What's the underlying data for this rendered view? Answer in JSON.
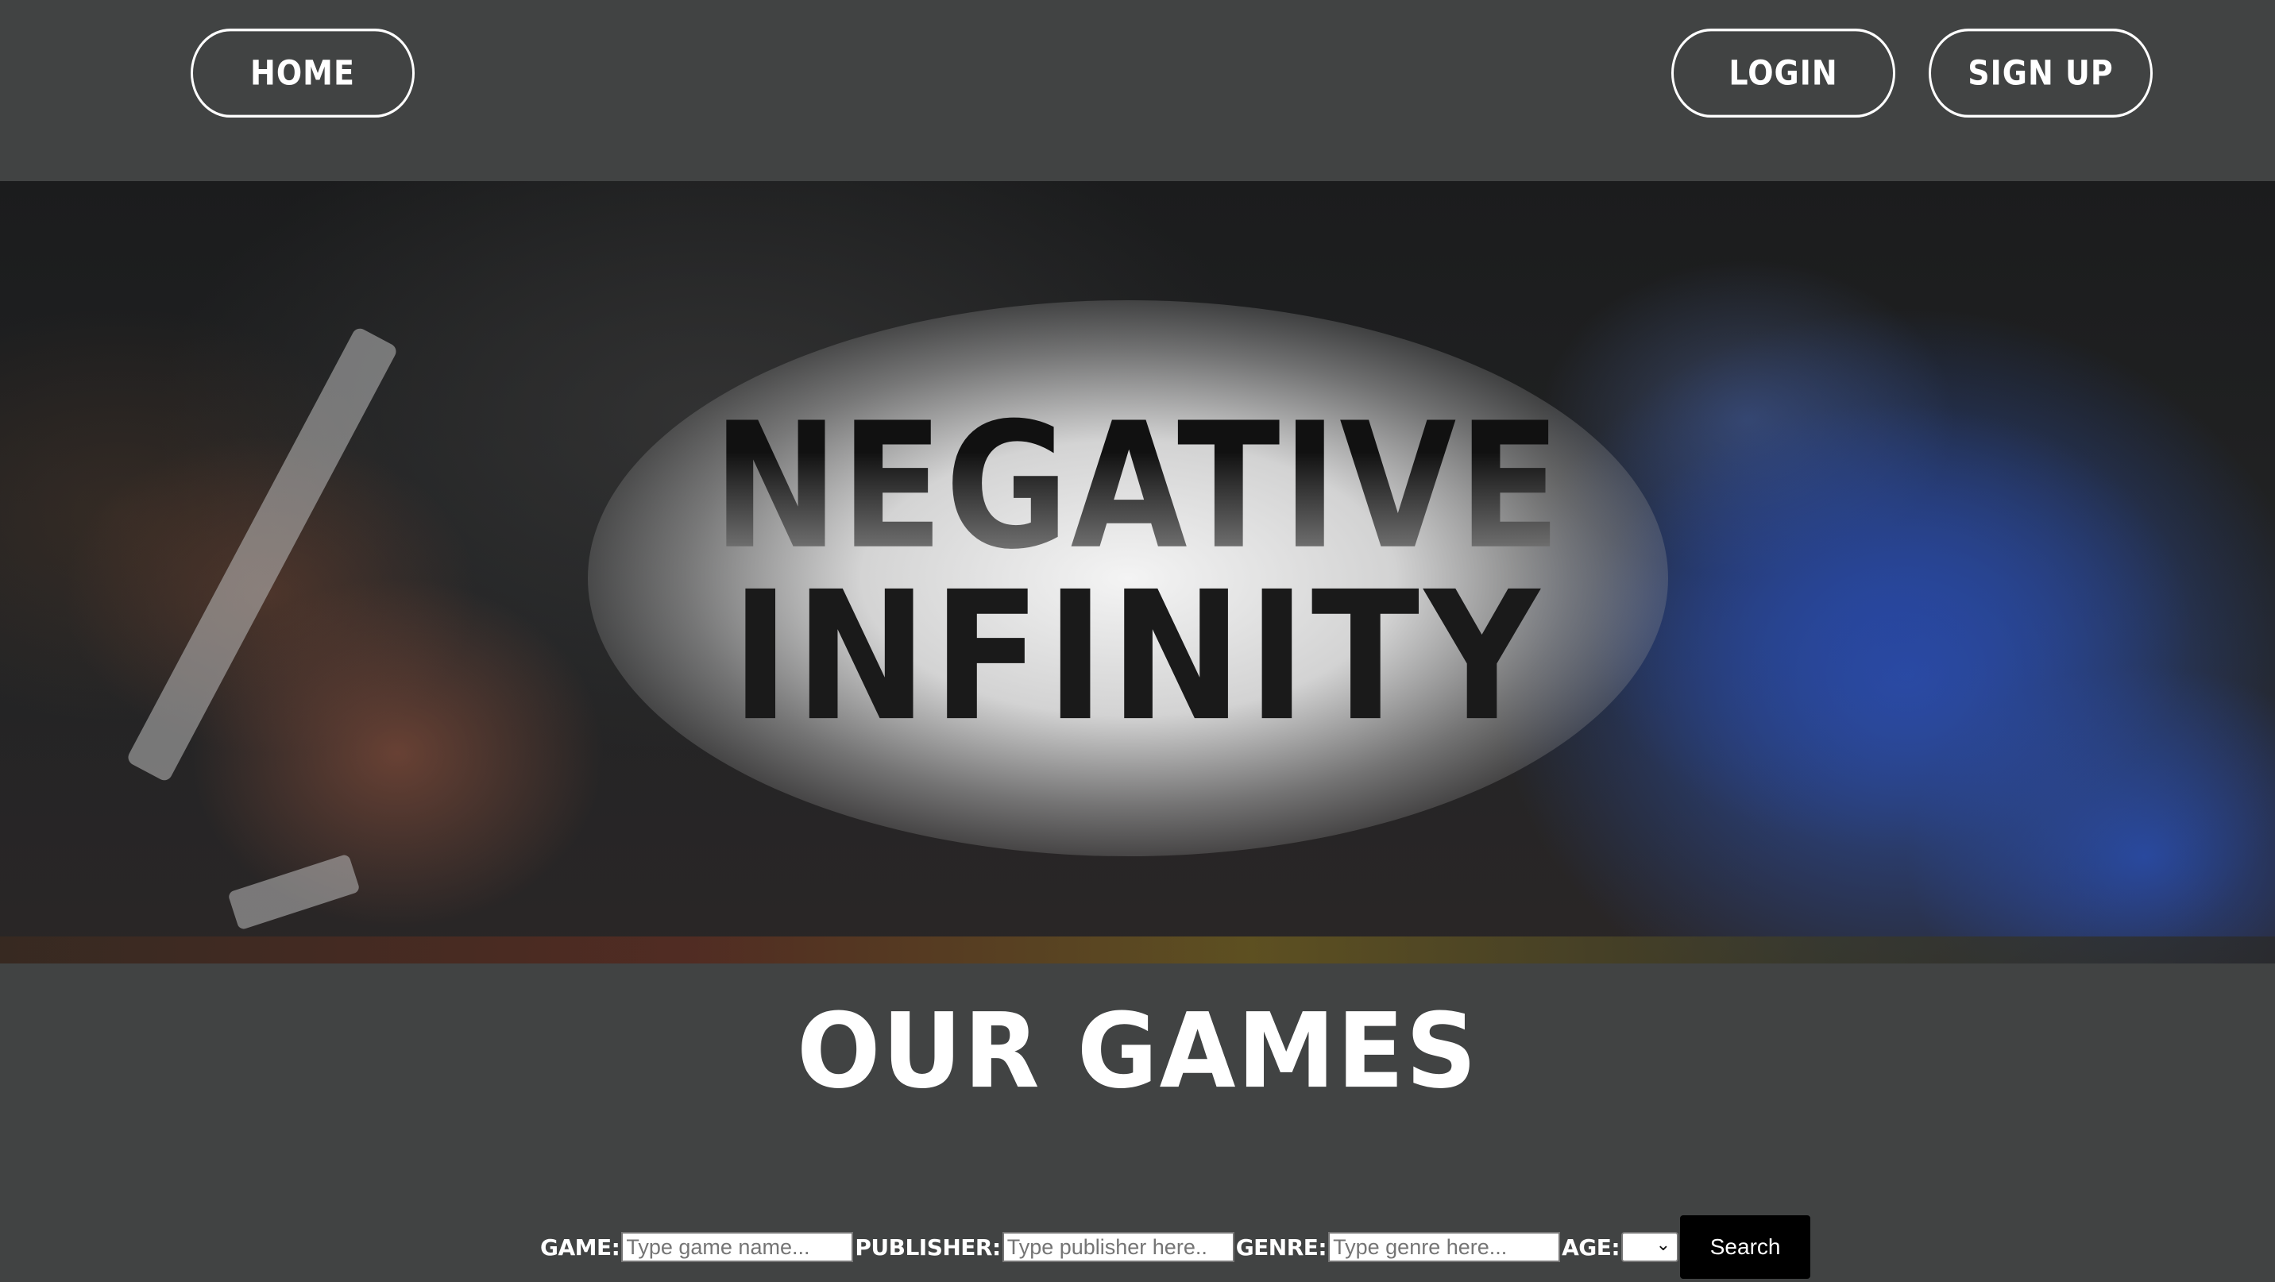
{
  "nav": {
    "home_label": "HOME",
    "login_label": "LOGIN",
    "signup_label": "SIGN UP"
  },
  "hero": {
    "title_line1": "NEGATIVE",
    "title_line2": "INFINITY"
  },
  "games_section": {
    "heading": "OUR GAMES"
  },
  "search": {
    "game_label": "GAME:",
    "game_placeholder": "Type game name...",
    "publisher_label": "PUBLISHER:",
    "publisher_placeholder": "Type publisher here..",
    "genre_label": "GENRE:",
    "genre_placeholder": "Type genre here...",
    "age_label": "AGE:",
    "age_selected": "",
    "age_icon": "chevron-down-icon",
    "button_label": "Search"
  },
  "colors": {
    "page_background": "#414343",
    "button_border": "#ffffff",
    "search_button": "#000000"
  }
}
